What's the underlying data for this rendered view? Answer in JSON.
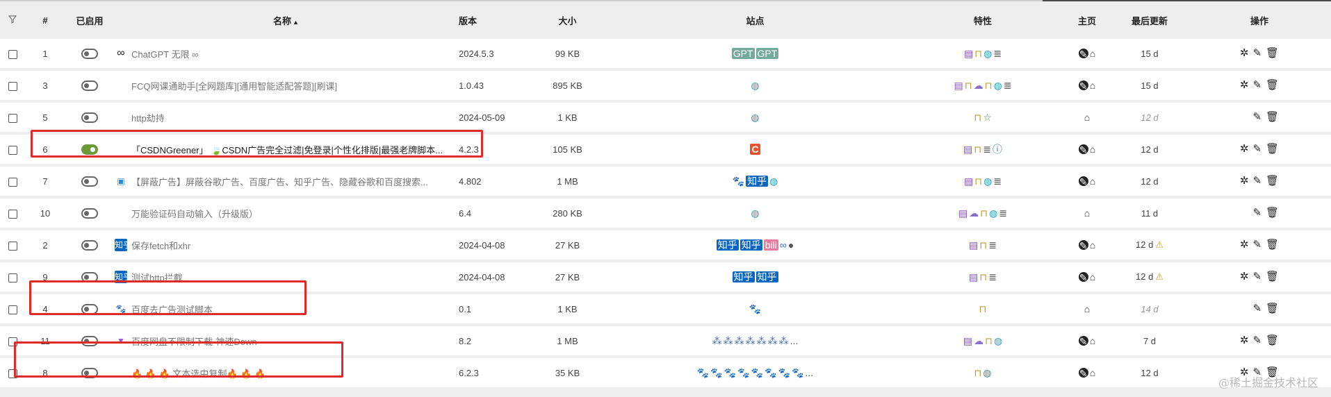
{
  "header": {
    "filter_icon": "filter-icon",
    "num": "#",
    "enabled": "已启用",
    "name": "名称",
    "sort_arrow": "▲",
    "version": "版本",
    "size": "大小",
    "sites": "站点",
    "features": "特性",
    "homepage": "主页",
    "updated": "最后更新",
    "actions": "操作"
  },
  "rows": [
    {
      "id": "1",
      "enabled": false,
      "name_icon": "∞",
      "name": "ChatGPT 无限 ∞",
      "version": "2024.5.3",
      "size": "99 KB",
      "updated": "15 d"
    },
    {
      "id": "3",
      "enabled": false,
      "name_icon": "",
      "name": "FCQ网课通助手[全网题库][通用智能适配答题][刷课]",
      "version": "1.0.43",
      "size": "895 KB",
      "updated": "15 d"
    },
    {
      "id": "5",
      "enabled": false,
      "name_icon": "",
      "name": "http劫持",
      "version": "2024-05-09",
      "size": "1 KB",
      "updated": "12 d"
    },
    {
      "id": "6",
      "enabled": true,
      "name_icon": "",
      "name": "「CSDNGreener」 🍃CSDN广告完全过滤|免登录|个性化排版|最强老牌脚本...",
      "version": "4.2.3",
      "size": "105 KB",
      "updated": "12 d"
    },
    {
      "id": "7",
      "enabled": false,
      "name_icon": "▣",
      "name": "【屏蔽广告】屏蔽谷歌广告、百度广告、知乎广告、隐藏谷歌和百度搜索...",
      "version": "4.802",
      "size": "1 MB",
      "updated": "12 d"
    },
    {
      "id": "10",
      "enabled": false,
      "name_icon": "",
      "name": "万能验证码自动输入（升级版）",
      "version": "6.4",
      "size": "280 KB",
      "updated": "11 d"
    },
    {
      "id": "2",
      "enabled": false,
      "name_icon": "知乎",
      "name": "保存fetch和xhr",
      "version": "2024-04-08",
      "size": "27 KB",
      "updated": "12 d"
    },
    {
      "id": "9",
      "enabled": false,
      "name_icon": "知乎",
      "name": "测试http拦截",
      "version": "2024-04-08",
      "size": "27 KB",
      "updated": "12 d"
    },
    {
      "id": "4",
      "enabled": false,
      "name_icon": "🐾",
      "name": "百度去广告测试脚本",
      "version": "0.1",
      "size": "1 KB",
      "updated": "14 d"
    },
    {
      "id": "11",
      "enabled": false,
      "name_icon": "▼",
      "name": "百度网盘不限制下载-神速Down",
      "version": "8.2",
      "size": "1 MB",
      "updated": "7 d"
    },
    {
      "id": "8",
      "enabled": false,
      "name_icon": "",
      "name": "🔥 🔥 🔥 文本选中复制🔥 🔥 🔥",
      "version": "6.2.3",
      "size": "35 KB",
      "updated": "12 d"
    }
  ],
  "site_labels": {
    "gpt": "GPT",
    "csdn": "C",
    "zhihu": "知乎",
    "bili": "bili",
    "ellipsis": "..."
  },
  "colors": {
    "enabled_toggle": "#6a9a3a",
    "highlight_border": "#e02a2a",
    "feature_doc": "#8a4fb8",
    "feature_lock": "#c69a30",
    "feature_globe": "#2a9bb0",
    "warning": "#c9a030"
  },
  "watermark": "@稀土掘金技术社区"
}
